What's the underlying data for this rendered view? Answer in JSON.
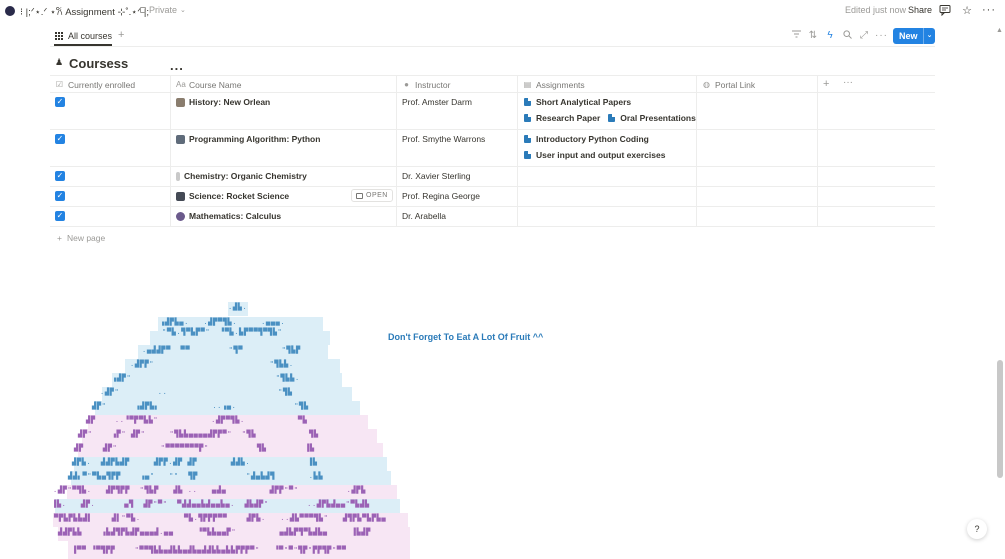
{
  "topbar": {
    "title": "⁝ |;ᐟ⋆.ᐟ ⋆𐙚 Assignment ⊹˚.⋆ᐟ |;",
    "privacy": "Private",
    "edited": "Edited just now",
    "share": "Share"
  },
  "view": {
    "tab_label": "All courses",
    "new_button": "New"
  },
  "database": {
    "title": "Coursess",
    "more": "...",
    "columns": [
      "Currently enrolled",
      "Course Name",
      "Instructor",
      "Assignments",
      "Portal Link"
    ],
    "rows": [
      {
        "enrolled": true,
        "course": "History: New Orlean",
        "instructor": "Prof. Amster Darm",
        "assignments_line1": [
          "Short Analytical Papers"
        ],
        "assignments_line2": [
          "Research Paper",
          "Oral Presentations"
        ]
      },
      {
        "enrolled": true,
        "course": "Programming Algorithm: Python",
        "instructor": "Prof. Smythe Warrons",
        "assignments_line1": [
          "Introductory Python Coding"
        ],
        "assignments_line2": [
          "User input and output exercises"
        ]
      },
      {
        "enrolled": true,
        "course": "Chemistry: Organic Chemistry",
        "instructor": "Dr. Xavier Sterling",
        "assignments_line1": [],
        "assignments_line2": []
      },
      {
        "enrolled": true,
        "course": "Science: Rocket Science",
        "instructor": "Prof. Regina George",
        "open_label": "OPEN",
        "assignments_line1": [],
        "assignments_line2": []
      },
      {
        "enrolled": true,
        "course": "Mathematics: Calculus",
        "instructor": "Dr. Arabella",
        "assignments_line1": [],
        "assignments_line2": []
      }
    ],
    "new_page": "New page"
  },
  "note": "Don't Forget To Eat A Lot Of Fruit ^^",
  "colors": {
    "accent": "#2383e2",
    "doc_icon": "#2b7bb9",
    "egg_blue": "#dceef7",
    "egg_pink": "#f7e6f4"
  }
}
